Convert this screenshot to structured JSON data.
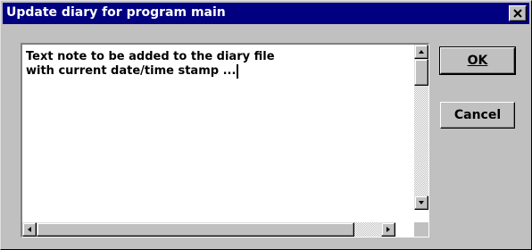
{
  "window": {
    "title": "Update diary for program main"
  },
  "editor": {
    "text": "Text note to be added to the diary file\nwith current date/time stamp ..."
  },
  "buttons": {
    "ok_label": "OK",
    "cancel_label": "Cancel"
  },
  "icons": {
    "close": "close-icon",
    "scroll_up": "arrow-up-icon",
    "scroll_down": "arrow-down-icon",
    "scroll_left": "arrow-left-icon",
    "scroll_right": "arrow-right-icon"
  },
  "colors": {
    "titlebar": "#000080",
    "face": "#c0c0c0",
    "editor_bg": "#ffffff"
  }
}
